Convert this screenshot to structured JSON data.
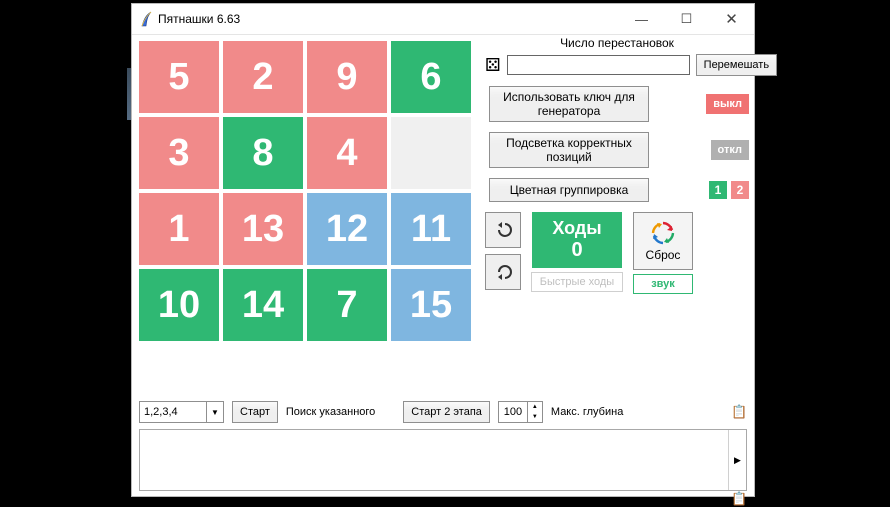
{
  "window": {
    "title": "Пятнашки 6.63"
  },
  "board": {
    "tiles": [
      {
        "n": "5",
        "c": "pink"
      },
      {
        "n": "2",
        "c": "pink"
      },
      {
        "n": "9",
        "c": "pink"
      },
      {
        "n": "6",
        "c": "green"
      },
      {
        "n": "3",
        "c": "pink"
      },
      {
        "n": "8",
        "c": "green"
      },
      {
        "n": "4",
        "c": "pink"
      },
      {
        "n": "",
        "c": "empty"
      },
      {
        "n": "1",
        "c": "pink"
      },
      {
        "n": "13",
        "c": "pink"
      },
      {
        "n": "12",
        "c": "blue"
      },
      {
        "n": "11",
        "c": "blue"
      },
      {
        "n": "10",
        "c": "green"
      },
      {
        "n": "14",
        "c": "green"
      },
      {
        "n": "7",
        "c": "green"
      },
      {
        "n": "15",
        "c": "blue"
      }
    ]
  },
  "panel": {
    "perm_label": "Число перестановок",
    "perm_value": "",
    "shuffle": "Перемешать",
    "use_key": "Использовать ключ для генератора",
    "use_key_state": "выкл",
    "highlight": "Подсветка корректных позиций",
    "highlight_state": "откл",
    "color_group": "Цветная группировка",
    "chip1": "1",
    "chip2": "2",
    "moves_label": "Ходы",
    "moves_count": "0",
    "reset": "Сброс",
    "fast": "Быстрые ходы",
    "sound": "звук"
  },
  "bottom": {
    "combo": "1,2,3,4",
    "start": "Старт",
    "search": "Поиск указанного",
    "start2": "Старт 2 этапа",
    "depth_val": "100",
    "depth_label": "Макс. глубина"
  }
}
